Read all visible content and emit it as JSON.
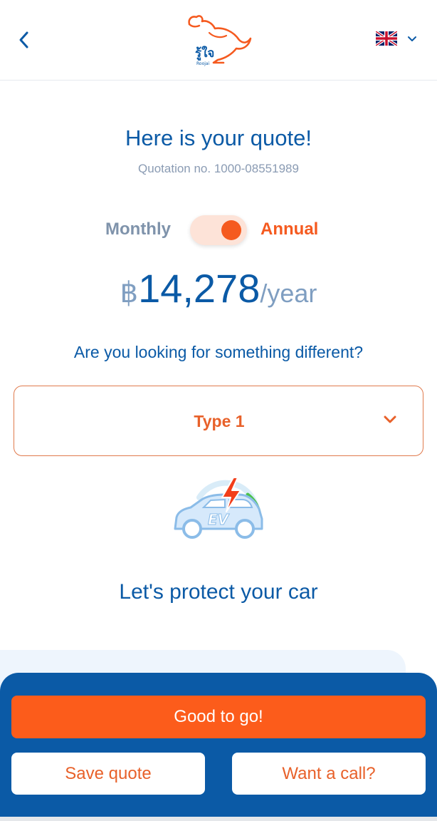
{
  "header": {
    "logo_text": "รู้ใจ",
    "logo_subtext": "Roojai",
    "language": "EN"
  },
  "quote": {
    "title": "Here is your quote!",
    "number": "Quotation no. 1000-08551989"
  },
  "billing": {
    "monthly_label": "Monthly",
    "annual_label": "Annual",
    "selected": "Annual"
  },
  "price": {
    "currency": "฿",
    "amount": "14,278",
    "period": "/year"
  },
  "different_prompt": "Are you looking for something different?",
  "type_select": {
    "value": "Type 1"
  },
  "ev": {
    "badge": "EV"
  },
  "protect_heading": "Let's protect your car",
  "actions": {
    "primary": "Good to go!",
    "save": "Save quote",
    "call": "Want a call?"
  },
  "colors": {
    "brand_blue": "#0b5aa6",
    "accent_orange": "#f55a1f",
    "muted": "#8a9bb3"
  }
}
